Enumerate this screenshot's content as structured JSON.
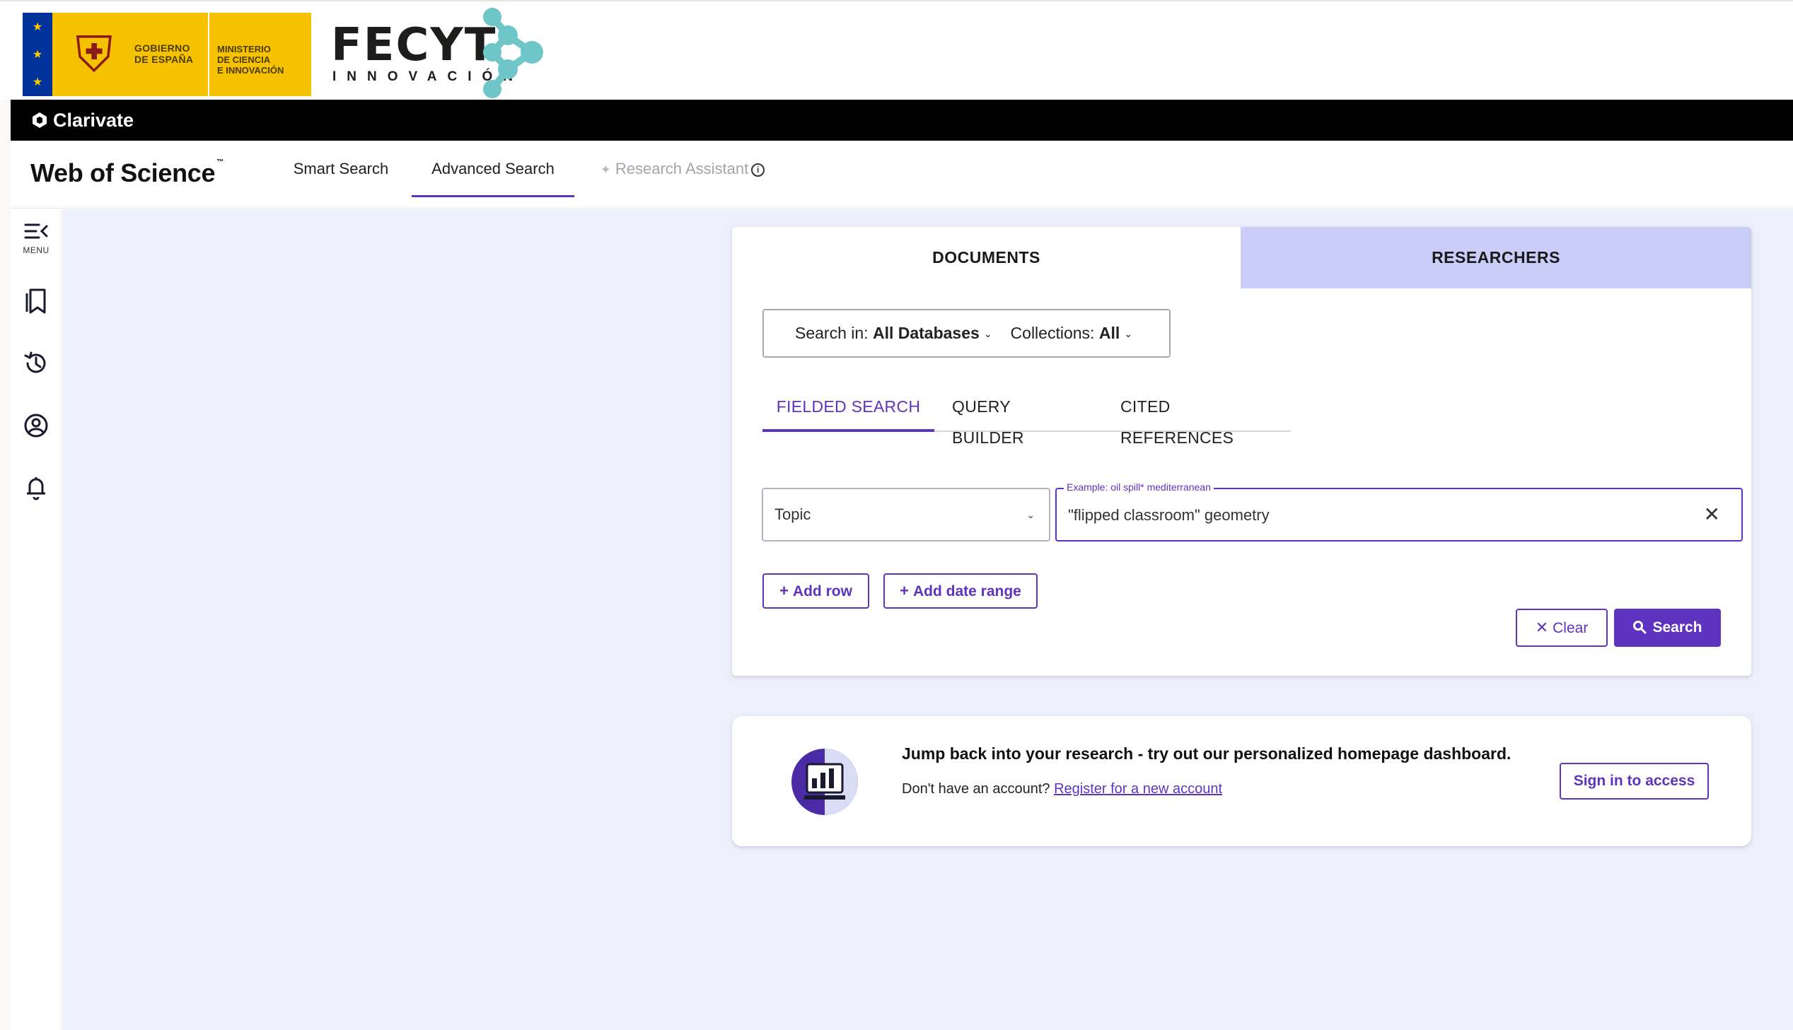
{
  "banner": {
    "gov_line1": "GOBIERNO\nDE ESPAÑA",
    "gov_line2": "MINISTERIO\nDE CIENCIA\nE INNOVACIÓN",
    "fecyt_name": "FECYT",
    "fecyt_sub": "INNOVACIÓN"
  },
  "clarivate": {
    "brand": "Clarivate"
  },
  "header": {
    "brand": "Web of Science",
    "brand_mark": "™",
    "tabs": [
      {
        "label": "Smart Search",
        "active": false
      },
      {
        "label": "Advanced Search",
        "active": true
      },
      {
        "label": "Research Assistant",
        "active": false,
        "disabled": true
      }
    ]
  },
  "rail": {
    "menu_label": "MENU",
    "icons": [
      "menu-collapse-icon",
      "bookmark-list-icon",
      "history-icon",
      "user-profile-icon",
      "bell-icon"
    ]
  },
  "search_card": {
    "tabs": [
      {
        "label": "DOCUMENTS",
        "active": true
      },
      {
        "label": "RESEARCHERS",
        "active": false
      }
    ],
    "search_in_label": "Search in:",
    "search_in_value": "All Databases",
    "collections_label": "Collections:",
    "collections_value": "All",
    "sub_tabs": [
      {
        "label": "FIELDED SEARCH",
        "active": true
      },
      {
        "label": "QUERY BUILDER",
        "active": false
      },
      {
        "label": "CITED REFERENCES",
        "active": false
      }
    ],
    "field_value": "Topic",
    "query_placeholder_legend": "Example: oil spill* mediterranean",
    "query_value": "\"flipped classroom\" geometry",
    "add_row_label": "Add row",
    "add_date_label": "Add date range",
    "clear_label": "Clear",
    "search_label": "Search"
  },
  "promo": {
    "headline": "Jump back into your research - try out our personalized homepage dashboard.",
    "sub_text": "Don't have an account?",
    "register_link": "Register for a new account",
    "signin_label": "Sign in to access"
  },
  "colors": {
    "accent": "#5e33bf",
    "researchers_tab": "#c9cdf8",
    "canvas": "#edf0fb",
    "gov_yellow": "#f6c200",
    "fecyt_teal": "#6ec6c9"
  }
}
